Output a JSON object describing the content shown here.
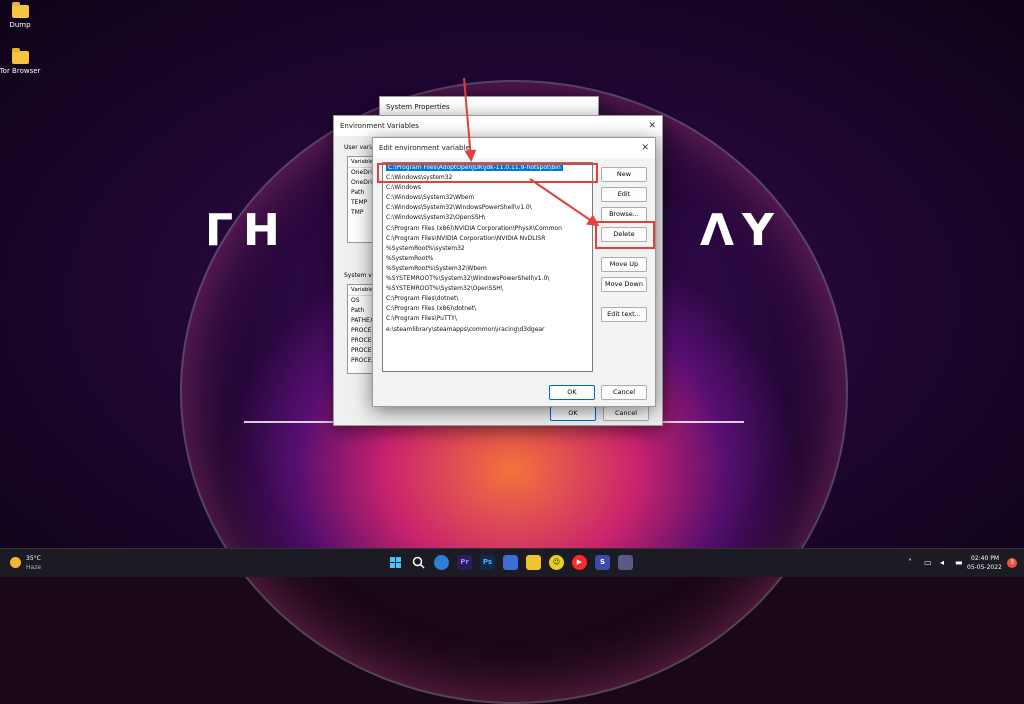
{
  "desktop": {
    "icons": [
      {
        "label": "Dump"
      },
      {
        "label": "Tor Browser"
      }
    ],
    "logo_left": "ГН",
    "logo_right": "ΛY"
  },
  "system_properties": {
    "title": "System Properties"
  },
  "environment_variables": {
    "title": "Environment Variables",
    "user_section_label": "User varia",
    "user_header": "Variable",
    "user_vars": [
      "OneDriv",
      "OneDriv",
      "Path",
      "TEMP",
      "TMP"
    ],
    "system_section_label": "System va",
    "system_header": "Variable",
    "system_vars": [
      "OS",
      "Path",
      "PATHEX",
      "PROCES",
      "PROCES",
      "PROCES",
      "PROCES"
    ],
    "ok_label": "OK",
    "cancel_label": "Cancel"
  },
  "edit_dialog": {
    "title": "Edit environment variable",
    "items": [
      "C:\\Program Files\\AdoptOpenJDK\\jdk-11.0.11.9-hotspot\\bin",
      "C:\\Windows\\system32",
      "C:\\Windows",
      "C:\\Windows\\System32\\Wbem",
      "C:\\Windows\\System32\\WindowsPowerShell\\v1.0\\",
      "C:\\Windows\\System32\\OpenSSH\\",
      "C:\\Program Files (x86)\\NVIDIA Corporation\\PhysX\\Common",
      "C:\\Program Files\\NVIDIA Corporation\\NVIDIA NvDLISR",
      "%SystemRoot%\\system32",
      "%SystemRoot%",
      "%SystemRoot%\\System32\\Wbem",
      "%SYSTEMROOT%\\System32\\WindowsPowerShell\\v1.0\\",
      "%SYSTEMROOT%\\System32\\OpenSSH\\",
      "C:\\Program Files\\dotnet\\",
      "C:\\Program Files (x86)\\dotnet\\",
      "C:\\Program Files\\PuTTY\\",
      "e:\\steamlibrary\\steamapps\\common\\iracing\\d3dgear"
    ],
    "buttons": {
      "new": "New",
      "edit": "Edit",
      "browse": "Browse...",
      "delete": "Delete",
      "move_up": "Move Up",
      "move_down": "Move Down",
      "edit_text": "Edit text..."
    },
    "ok_label": "OK",
    "cancel_label": "Cancel"
  },
  "taskbar": {
    "weather_temp": "35°C",
    "weather_desc": "Haze",
    "time": "02:40 PM",
    "date": "05-05-2022",
    "notification_count": "3"
  },
  "colors": {
    "annotation": "#e0413d",
    "selection": "#0078d7"
  }
}
